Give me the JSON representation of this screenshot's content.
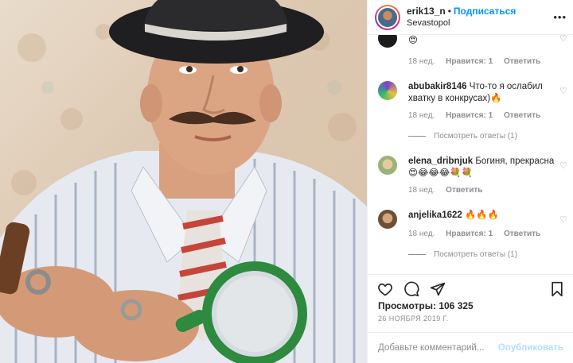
{
  "header": {
    "username": "erik13_n",
    "separator": "•",
    "follow_label": "Подписаться",
    "location": "Sevastopol",
    "more_icon": "more-dots-icon"
  },
  "comments": [
    {
      "username": "",
      "text": "😍",
      "time": "18 нед.",
      "likes": "Нравится: 1",
      "reply": "Ответить",
      "view_replies": ""
    },
    {
      "username": "abubakir8146",
      "text": "Что-то я ослабил хватку в конкрусах)🔥",
      "time": "18 нед.",
      "likes": "Нравится: 1",
      "reply": "Ответить",
      "view_replies": "Посмотреть ответы (1)"
    },
    {
      "username": "elena_dribnjuk",
      "text": "Богиня, прекрасна 😍😂😂😂💐💐",
      "time": "18 нед.",
      "likes": "",
      "reply": "Ответить",
      "view_replies": ""
    },
    {
      "username": "anjelika1622",
      "text": "🔥🔥🔥",
      "time": "18 нед.",
      "likes": "Нравится: 1",
      "reply": "Ответить",
      "view_replies": "Посмотреть ответы (1)"
    }
  ],
  "actions": {
    "like_icon": "heart-icon",
    "comment_icon": "comment-icon",
    "share_icon": "send-icon",
    "save_icon": "bookmark-icon"
  },
  "views": "Просмотры: 106 325",
  "date": "26 НОЯБРЯ 2019 Г.",
  "add_comment": {
    "placeholder": "Добавьте комментарий...",
    "publish_label": "Опубликовать"
  },
  "colors": {
    "accent": "#0095f6",
    "publish_disabled": "#b2dffc",
    "meta": "#8e8e8e",
    "border": "#efefef"
  }
}
